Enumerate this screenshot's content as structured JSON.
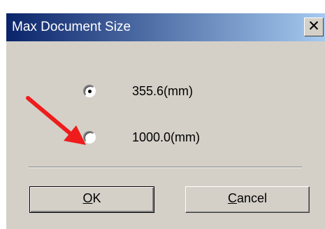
{
  "window": {
    "title": "Max Document Size",
    "close_glyph": "✕"
  },
  "options": [
    {
      "label": "355.6(mm)",
      "selected": true
    },
    {
      "label": "1000.0(mm)",
      "selected": false
    }
  ],
  "buttons": {
    "ok": {
      "mnemonic": "O",
      "rest": "K"
    },
    "cancel": {
      "mnemonic": "C",
      "rest": "ancel"
    }
  },
  "annotation": {
    "arrow_color": "#ee1c1c",
    "icon": "red-arrow-icon"
  },
  "colors": {
    "dialog_bg": "#d4d0c8",
    "title_start": "#0a246a",
    "title_end": "#a6caf0"
  }
}
